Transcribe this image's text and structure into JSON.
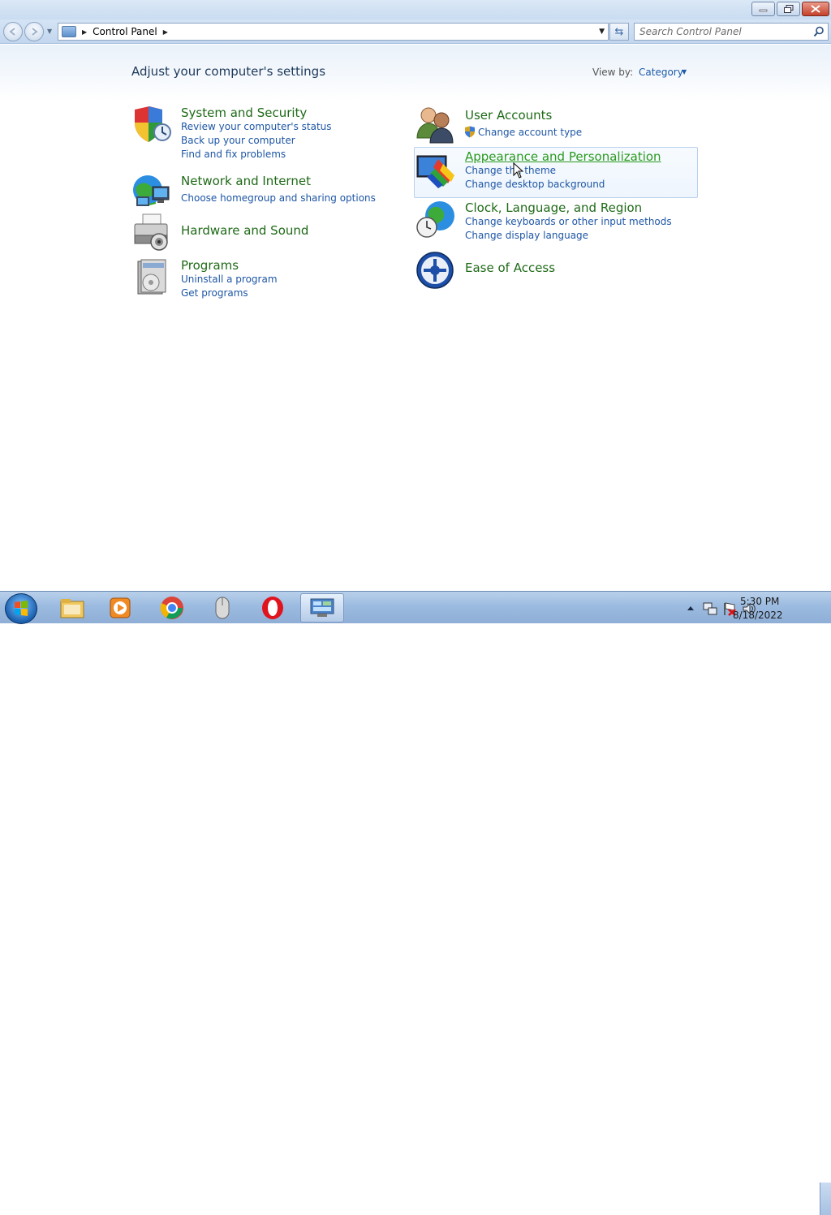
{
  "window": {
    "caption_buttons": {
      "minimize": "minimize",
      "maximize": "maximize",
      "close": "close"
    }
  },
  "navbar": {
    "breadcrumb": [
      "Control Panel"
    ],
    "search_placeholder": "Search Control Panel"
  },
  "content": {
    "title": "Adjust your computer's settings",
    "view_by_label": "View by:",
    "view_by_value": "Category",
    "categories_left": [
      {
        "title": "System and Security",
        "links": [
          "Review your computer's status",
          "Back up your computer",
          "Find and fix problems"
        ]
      },
      {
        "title": "Network and Internet",
        "links": [
          "Choose homegroup and sharing options"
        ]
      },
      {
        "title": "Hardware and Sound",
        "links": []
      },
      {
        "title": "Programs",
        "links": [
          "Uninstall a program",
          "Get programs"
        ]
      }
    ],
    "categories_right": [
      {
        "title": "User Accounts",
        "links": [
          "Change account type"
        ]
      },
      {
        "title": "Appearance and Personalization",
        "links": [
          "Change the theme",
          "Change desktop background"
        ]
      },
      {
        "title": "Clock, Language, and Region",
        "links": [
          "Change keyboards or other input methods",
          "Change display language"
        ]
      },
      {
        "title": "Ease of Access",
        "links": []
      }
    ]
  },
  "taskbar": {
    "apps": [
      "windows-explorer",
      "media-player",
      "chrome",
      "mouse",
      "opera",
      "control-panel"
    ],
    "active_app": "control-panel",
    "clock_time": "5:30 PM",
    "clock_date": "8/18/2022"
  },
  "colors": {
    "category_title": "#1e6a17",
    "link": "#1e56a5",
    "hover_title": "#2a9a1e",
    "page_title": "#1e395b"
  }
}
